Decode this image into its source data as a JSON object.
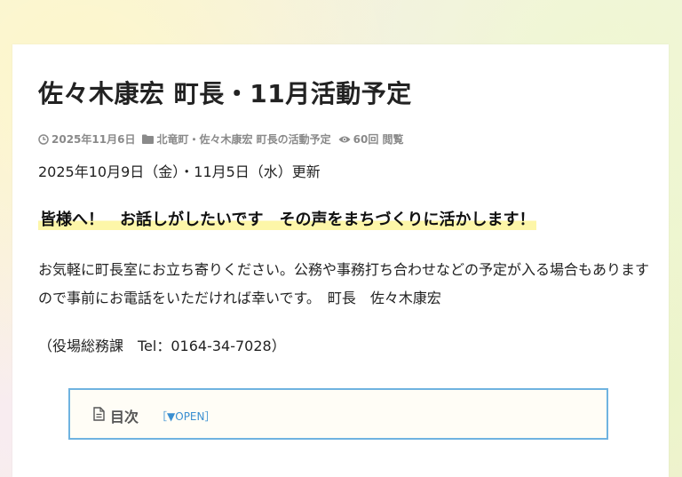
{
  "post": {
    "title": "佐々木康宏 町長・11月活動予定",
    "meta": {
      "date": "2025年11月6日",
      "category": "北竜町・佐々木康宏 町長の活動予定",
      "views": "60回 閲覧"
    },
    "updated": "2025年10月9日（金）・11月5日（水）更新",
    "headline": "皆様へ！　お話しがしたいです　その声をまちづくりに活かします！",
    "body": "お気軽に町長室にお立ち寄りください。公務や事務打ち合わせなどの予定が入る場合もありますので事前にお電話をいただければ幸いです。　町長　佐々木康宏",
    "contact": "（役場総務課　Tel：0164-34-7028）"
  },
  "toc": {
    "title": "目次",
    "toggle_label": "［▼OPEN］"
  },
  "icons": {
    "date": "clock-icon",
    "category": "folder-icon",
    "views": "eye-icon",
    "toc": "document-icon"
  },
  "colors": {
    "highlight": "#fdf6a8",
    "toc_border": "#6fb3e0",
    "toc_toggle": "#3a8fd1",
    "meta_text": "#8a8a8a"
  }
}
